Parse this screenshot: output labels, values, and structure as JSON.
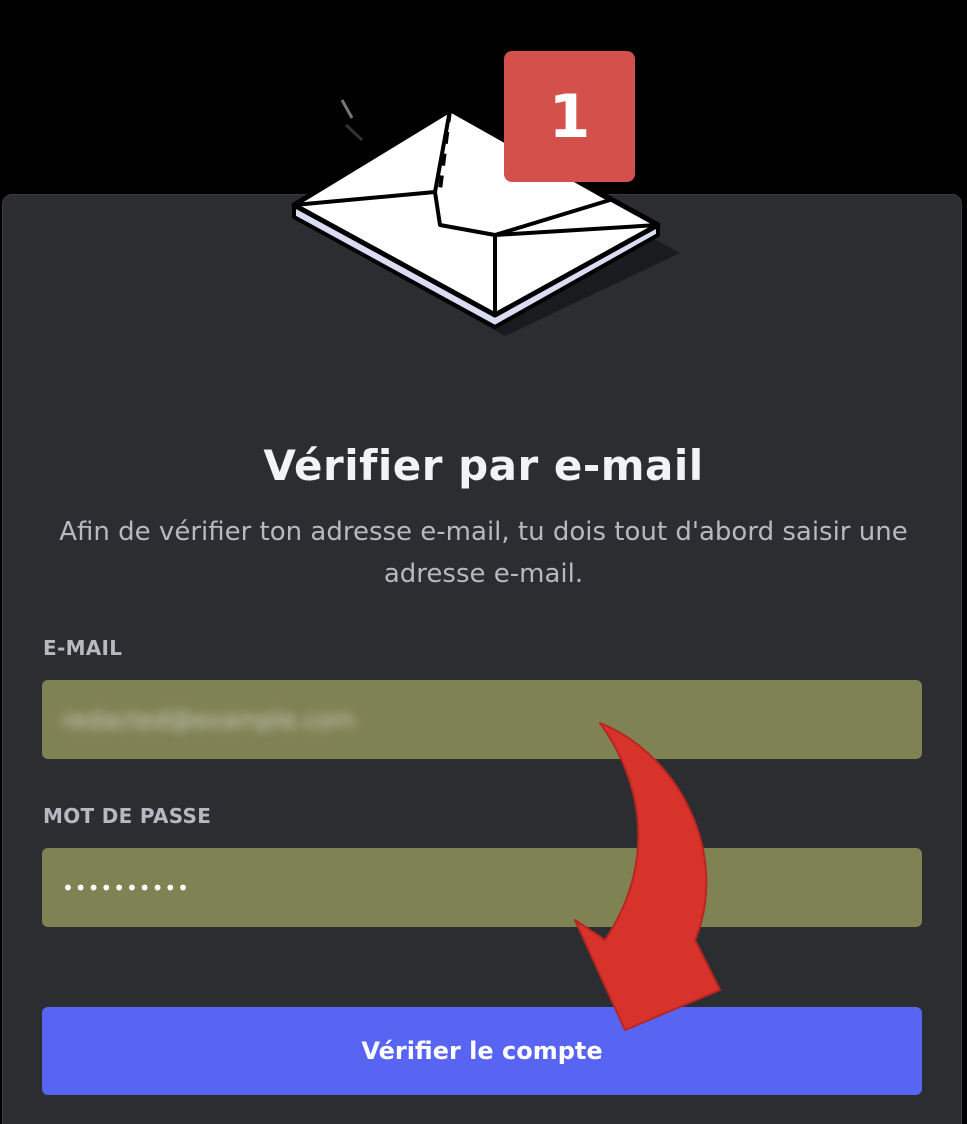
{
  "badge": {
    "count": "1"
  },
  "illustration": {
    "icon": "envelope-icon"
  },
  "dialog": {
    "title": "Vérifier par e-mail",
    "subtitle": "Afin de vérifier ton adresse e-mail, tu dois tout d'abord saisir une adresse e-mail."
  },
  "form": {
    "email_label": "E-MAIL",
    "email_value": "redacted@example.com",
    "password_label": "MOT DE PASSE",
    "password_value": "••••••••••",
    "submit_label": "Vérifier le compte"
  },
  "annotation": {
    "icon": "curved-arrow-icon",
    "color": "#d8332b"
  },
  "colors": {
    "background": "#000000",
    "modal": "#2b2d31",
    "field_fill": "#7f8253",
    "button": "#5865f2",
    "badge": "#d4504b"
  }
}
